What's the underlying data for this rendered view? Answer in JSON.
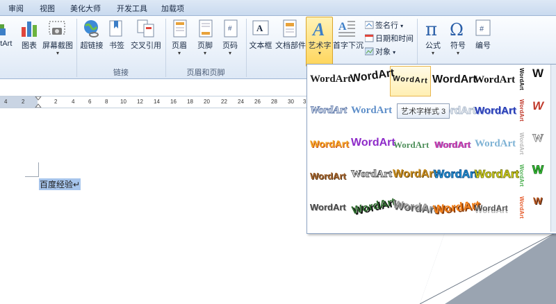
{
  "tabs": [
    "审阅",
    "视图",
    "美化大师",
    "开发工具",
    "加载项"
  ],
  "ribbon": {
    "buttons": {
      "smartart": "rtArt",
      "chart": "图表",
      "screenshot": "屏幕截图",
      "hyperlink": "超链接",
      "bookmark": "书签",
      "crossref": "交叉引用",
      "header": "页眉",
      "footer": "页脚",
      "pagenum": "页码",
      "textbox": "文本框",
      "docparts": "文档部件",
      "wordart": "艺术字",
      "dropcap": "首字下沉",
      "signature": "签名行",
      "datetime": "日期和时间",
      "object": "对象",
      "equation": "公式",
      "symbol": "符号",
      "number": "编号"
    },
    "groups": {
      "links": "链接",
      "headerfooter": "页眉和页脚"
    }
  },
  "ruler": {
    "ticks": [
      "4",
      "2",
      "2",
      "4",
      "6",
      "8",
      "10",
      "12",
      "14",
      "16",
      "18",
      "20",
      "22",
      "24",
      "26",
      "28",
      "30",
      "3"
    ]
  },
  "document": {
    "text": "百度经验↵"
  },
  "gallery": {
    "sample": "WordArt",
    "tooltip": "艺术字样式 3",
    "side_sample": "W"
  },
  "colors": {
    "accent": "#ffd55a",
    "tab_bg": "#c9daef",
    "selection": "#a7c5ec"
  }
}
